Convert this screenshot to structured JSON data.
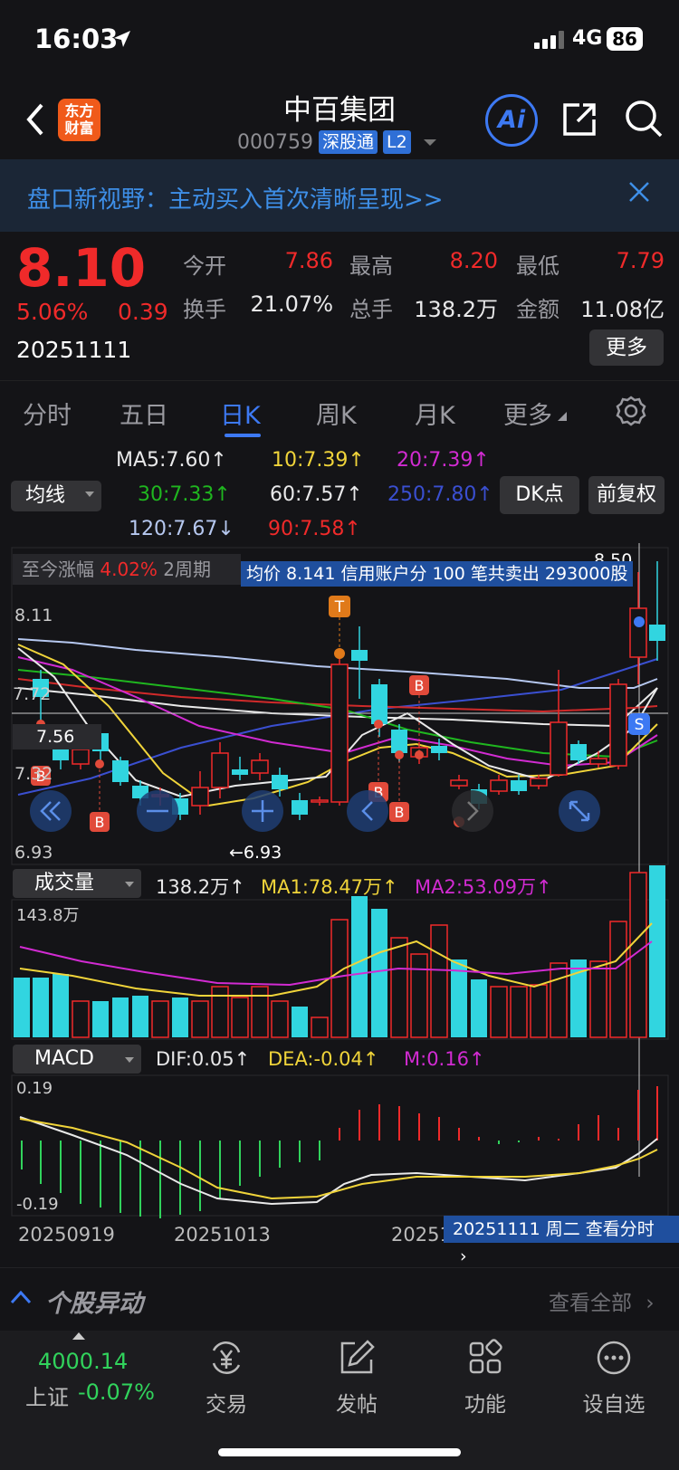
{
  "status": {
    "time": "16:03",
    "network": "4G",
    "battery": "86"
  },
  "header": {
    "stock_name": "中百集团",
    "code": "000759",
    "tag1": "深股通",
    "tag2": "L2",
    "logo_line1": "东方",
    "logo_line2": "财富",
    "ai_label": "Ai"
  },
  "banner": {
    "text": "盘口新视野：主动买入首次清晰呈现>>"
  },
  "quote": {
    "price": "8.10",
    "change_pct": "5.06%",
    "change_amt": "0.39",
    "date": "20251111",
    "open_label": "今开",
    "open": "7.86",
    "high_label": "最高",
    "high": "8.20",
    "low_label": "最低",
    "low": "7.79",
    "turnover_label": "换手",
    "turnover": "21.07%",
    "volume_label": "总手",
    "volume": "138.2万",
    "amount_label": "金额",
    "amount": "11.08亿",
    "more_btn": "更多"
  },
  "tabs": [
    "分时",
    "五日",
    "日K",
    "周K",
    "月K",
    "更多"
  ],
  "active_tab": 2,
  "ma": {
    "ma5": "MA5:7.60↑",
    "ma10": "10:7.39↑",
    "ma20": "20:7.39↑",
    "ma30": "30:7.33↑",
    "ma60": "60:7.57↑",
    "ma250": "250:7.80↑",
    "ma120": "120:7.67↓",
    "ma90": "90:7.58↑",
    "selector": "均线",
    "dk_btn": "DK点",
    "fq_btn": "前复权"
  },
  "chart_info": {
    "gain_label": "至今涨幅",
    "gain_value": "4.02%",
    "period": "2周期",
    "trade_info": "均价 8.141 信用账户分 100 笔共卖出 293000股",
    "high_mark": "8.50",
    "low_mark": "←6.93",
    "price_8_11": "8.11",
    "price_7_72": "7.72",
    "price_7_56": "7.56",
    "price_7_32": "7.32",
    "price_6_93": "6.93"
  },
  "volume": {
    "selector": "成交量",
    "value": "138.2万↑",
    "ma1": "MA1:78.47万↑",
    "ma2": "MA2:53.09万↑",
    "max": "143.8万"
  },
  "macd": {
    "selector": "MACD",
    "dif": "DIF:0.05↑",
    "dea": "DEA:-0.04↑",
    "m": "M:0.16↑",
    "top": "0.19",
    "bottom": "-0.19"
  },
  "x_dates": [
    "20250919",
    "20251013",
    "20251"
  ],
  "date_pill": "20251111 周二 查看分时",
  "anomaly": {
    "title": "个股异动",
    "view_all": "查看全部"
  },
  "bottom_nav": {
    "index_value": "4000.14",
    "index_name": "上证",
    "index_change": "-0.07%",
    "items": [
      "交易",
      "发帖",
      "功能",
      "设自选"
    ]
  },
  "colors": {
    "up": "#f02a2a",
    "down": "#31d5e0",
    "accent": "#3d79f3",
    "ma5": "#e9e9e9",
    "ma10": "#f0d43a",
    "ma20": "#d22bd2",
    "ma30": "#1fb61f",
    "ma250": "#3a4fd0"
  }
}
